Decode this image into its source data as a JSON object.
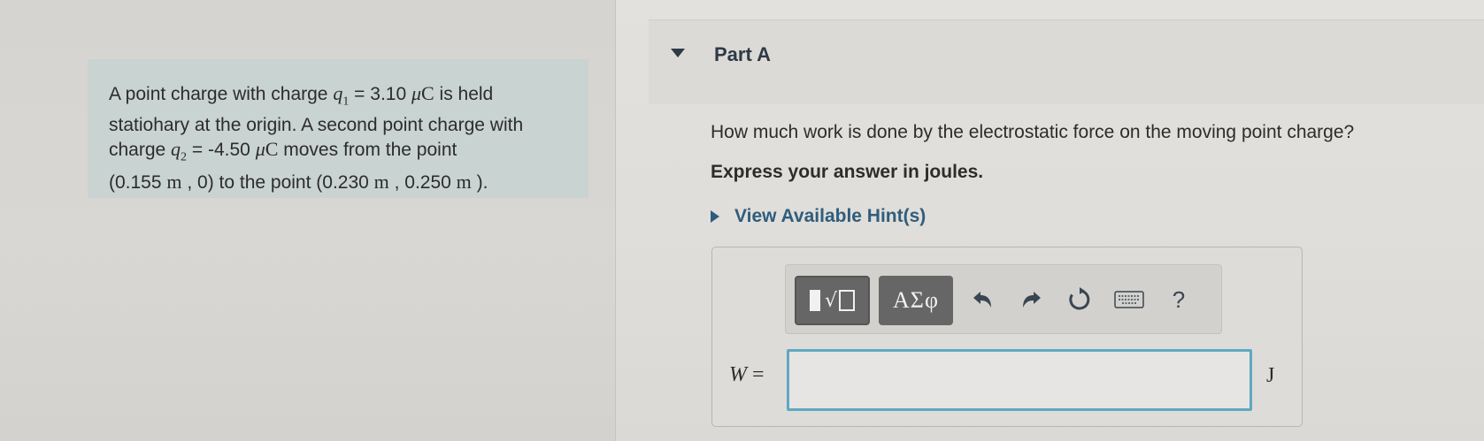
{
  "problem": {
    "line1_a": "A point charge with charge ",
    "q1_var": "q",
    "q1_sub": "1",
    "line1_b": " = 3.10 ",
    "mu": "μ",
    "coulomb": "C",
    "line1_c": " is held",
    "line2": "statiohary at the origin. A second point charge with",
    "line3_a": "charge ",
    "q2_var": "q",
    "q2_sub": "2",
    "line3_b": " = -4.50 ",
    "line3_c": " moves from the point",
    "line4_a": "(0.155 ",
    "m": "m",
    "line4_b": " , 0) to the point (0.230 ",
    "line4_c": " , 0.250 ",
    "line4_d": " )."
  },
  "part": {
    "title": "Part A",
    "question": "How much work is done by the electrostatic force on the moving point charge?",
    "instruction": "Express your answer in joules.",
    "hints_label": "View Available Hint(s)"
  },
  "toolbar": {
    "radical_glyph": "√",
    "greek_label": "ΑΣφ",
    "undo_icon": "undo-icon",
    "redo_icon": "redo-icon",
    "reset_icon": "reset-icon",
    "keyboard_icon": "keyboard-icon",
    "help_label": "?"
  },
  "answer": {
    "variable": "W",
    "equals": " =",
    "value": "",
    "unit": "J"
  },
  "colors": {
    "problem_bg": "#c9d3d1",
    "link": "#2f5d7c",
    "input_border": "#5fa8c2",
    "toolbar_button": "#666666"
  }
}
